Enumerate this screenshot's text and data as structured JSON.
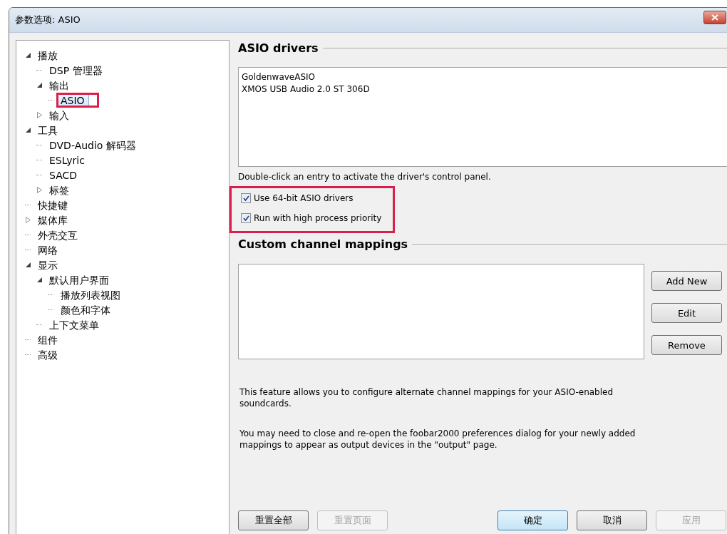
{
  "window": {
    "title": "参数选项: ASIO"
  },
  "tree": [
    {
      "label": "播放",
      "expanded": true,
      "children": [
        {
          "label": "DSP 管理器"
        },
        {
          "label": "输出",
          "expanded": true,
          "children": [
            {
              "label": "ASIO",
              "selected": true,
              "marked": true
            }
          ]
        },
        {
          "label": "输入",
          "expanded": false
        }
      ]
    },
    {
      "label": "工具",
      "expanded": true,
      "children": [
        {
          "label": "DVD-Audio 解码器"
        },
        {
          "label": "ESLyric"
        },
        {
          "label": "SACD"
        },
        {
          "label": "标签",
          "expanded": false
        }
      ]
    },
    {
      "label": "快捷键"
    },
    {
      "label": "媒体库",
      "expanded": false
    },
    {
      "label": "外壳交互"
    },
    {
      "label": "网络"
    },
    {
      "label": "显示",
      "expanded": true,
      "children": [
        {
          "label": "默认用户界面",
          "expanded": true,
          "children": [
            {
              "label": "播放列表视图"
            },
            {
              "label": "颜色和字体"
            }
          ]
        },
        {
          "label": "上下文菜单"
        }
      ]
    },
    {
      "label": "组件"
    },
    {
      "label": "高级"
    }
  ],
  "asio_drivers": {
    "heading": "ASIO drivers",
    "drivers": [
      "GoldenwaveASIO",
      "XMOS USB Audio 2.0 ST 306D"
    ],
    "hint": "Double-click an entry to activate the driver's control panel.",
    "options_marked": true,
    "options": [
      {
        "label": "Use 64-bit ASIO drivers",
        "checked": true
      },
      {
        "label": "Run with high process priority",
        "checked": true
      }
    ]
  },
  "channel_mappings": {
    "heading": "Custom channel mappings",
    "buttons": [
      "Add New",
      "Edit",
      "Remove"
    ],
    "notes": [
      "This feature allows you to configure alternate channel mappings for your ASIO-enabled soundcards.",
      "You may need to close and re-open the foobar2000 preferences dialog for your newly added mappings to appear as output devices in the \"output\" page."
    ]
  },
  "footer": {
    "left": [
      {
        "label": "重置全部",
        "disabled": false
      },
      {
        "label": "重置页面",
        "disabled": true
      }
    ],
    "right": [
      {
        "label": "确定",
        "disabled": false,
        "default": true
      },
      {
        "label": "取消",
        "disabled": false,
        "default": false
      },
      {
        "label": "应用",
        "disabled": true,
        "default": false
      }
    ]
  }
}
